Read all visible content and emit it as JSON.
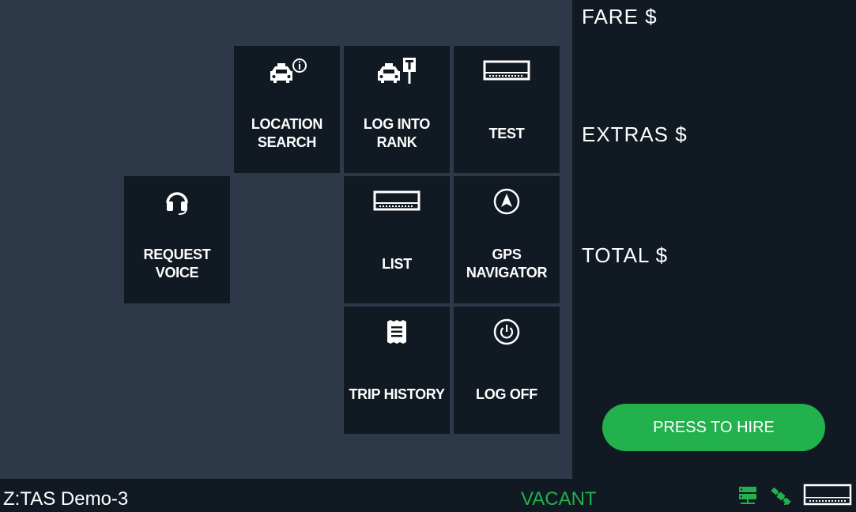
{
  "tiles": {
    "location_search": {
      "label": "LOCATION\nSEARCH",
      "icon": "taxi-info-icon"
    },
    "log_into_rank": {
      "label": "LOG INTO\nRANK",
      "icon": "taxi-rank-icon"
    },
    "test": {
      "label": "TEST",
      "icon": "meter-icon"
    },
    "request_voice": {
      "label": "REQUEST\nVOICE",
      "icon": "headset-icon"
    },
    "list": {
      "label": "LIST",
      "icon": "meter-icon"
    },
    "gps_navigator": {
      "label": "GPS\nNAVIGATOR",
      "icon": "navigation-icon"
    },
    "trip_history": {
      "label": "TRIP HISTORY",
      "icon": "receipt-icon"
    },
    "log_off": {
      "label": "LOG OFF",
      "icon": "power-icon"
    }
  },
  "totals": {
    "fare_label": "FARE $",
    "extras_label": "EXTRAS $",
    "total_label": "TOTAL $"
  },
  "hire_button": {
    "label": "PRESS TO HIRE"
  },
  "status_bar": {
    "device_name": "Z:TAS Demo-3",
    "status": "VACANT",
    "icons": [
      "server-icon",
      "satellite-icon",
      "meter-icon"
    ]
  },
  "colors": {
    "main_bg": "#2d3949",
    "tile_bg": "#111923",
    "accent_green": "#22b14c"
  }
}
